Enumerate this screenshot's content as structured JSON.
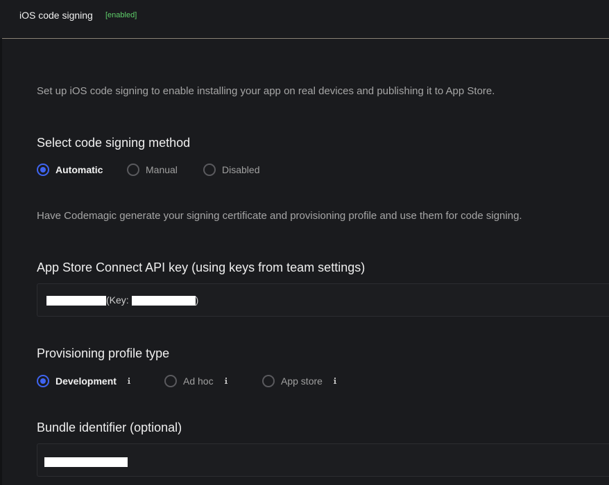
{
  "header": {
    "title": "iOS code signing",
    "badge": "[enabled]"
  },
  "intro": "Set up iOS code signing to enable installing your app on real devices and publishing it to App Store.",
  "signing_method": {
    "title": "Select code signing method",
    "options": [
      {
        "label": "Automatic",
        "checked": true
      },
      {
        "label": "Manual",
        "checked": false
      },
      {
        "label": "Disabled",
        "checked": false
      }
    ],
    "description": "Have Codemagic generate your signing certificate and provisioning profile and use them for code signing."
  },
  "api_key": {
    "title": "App Store Connect API key (using keys from team settings)",
    "key_prefix": "(Key: ",
    "key_suffix": ")"
  },
  "provisioning": {
    "title": "Provisioning profile type",
    "options": [
      {
        "label": "Development",
        "checked": true,
        "icon": "info-icon"
      },
      {
        "label": "Ad hoc",
        "checked": false,
        "icon": "info-icon"
      },
      {
        "label": "App store",
        "checked": false,
        "icon": "info-icon"
      }
    ]
  },
  "bundle": {
    "title": "Bundle identifier (optional)"
  },
  "colors": {
    "background": "#1a1b1e",
    "accent": "#3f64f0",
    "enabled": "#5fcf6a",
    "divider": "#8a8276"
  }
}
